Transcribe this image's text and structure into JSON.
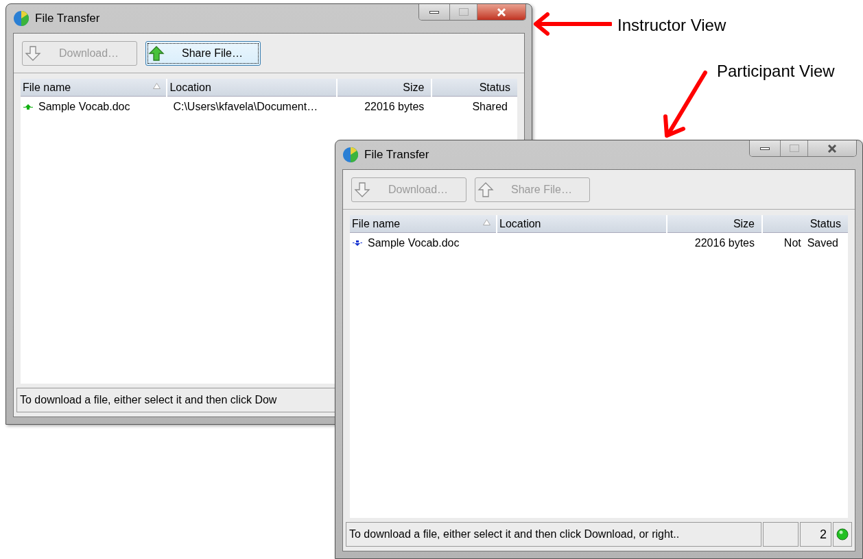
{
  "windows": [
    {
      "title": "File Transfer",
      "active": true,
      "buttons": [
        {
          "label": "Download…",
          "kind": "download",
          "disabled": true,
          "focused": false
        },
        {
          "label": "Share File…",
          "kind": "share",
          "disabled": false,
          "focused": true
        }
      ],
      "columns": [
        {
          "label": "File name",
          "sorted": true
        },
        {
          "label": "Location",
          "sorted": false
        },
        {
          "label": "Size",
          "sorted": false
        },
        {
          "label": "Status",
          "sorted": false
        }
      ],
      "rows": [
        {
          "kind": "upload",
          "file_name": "Sample Vocab.doc",
          "location": "C:\\Users\\kfavela\\Document…",
          "size": "22016 bytes",
          "status": "Shared"
        }
      ],
      "status_bar": {
        "message": "To download a file, either select it and then click Dow"
      }
    },
    {
      "title": "File Transfer",
      "active": false,
      "buttons": [
        {
          "label": "Download…",
          "kind": "download",
          "disabled": true,
          "focused": false
        },
        {
          "label": "Share File…",
          "kind": "share",
          "disabled": true,
          "focused": false
        }
      ],
      "columns": [
        {
          "label": "File name",
          "sorted": true
        },
        {
          "label": "Location",
          "sorted": false
        },
        {
          "label": "Size",
          "sorted": false
        },
        {
          "label": "Status",
          "sorted": false
        }
      ],
      "rows": [
        {
          "kind": "download",
          "file_name": "Sample Vocab.doc",
          "size": "22016 bytes",
          "status": "Not  Saved"
        }
      ],
      "status_bar": {
        "message": "To download a file, either select it and then click Download, or right..",
        "count": "2"
      }
    }
  ],
  "annotations": [
    {
      "text": "Instructor View"
    },
    {
      "text": "Participant View"
    }
  ]
}
